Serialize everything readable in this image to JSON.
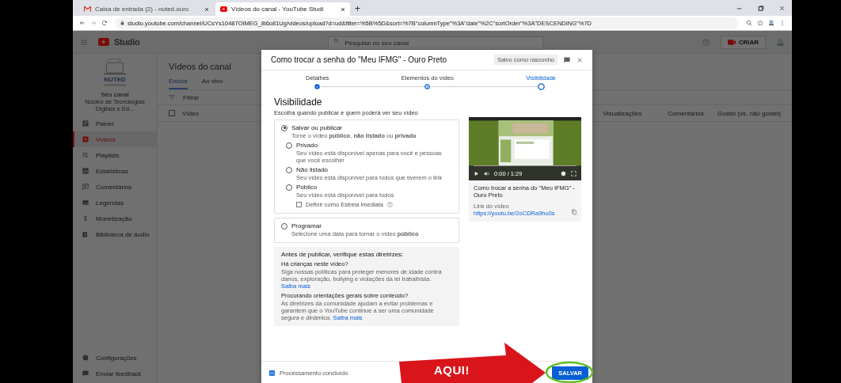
{
  "browser": {
    "tabs": [
      {
        "title": "Caixa de entrada (2) - nuted.ouro",
        "selected": false
      },
      {
        "title": "Vídeos do canal - YouTube Studi",
        "selected": true
      }
    ],
    "new_tab": "+",
    "url": "studio.youtube.com/channel/UCsYs10487OIMEG_8i6o81Ug/videos/upload?d=ud&filter=%5B%5D&sort=%7B\"columnType\"%3A\"date\"%2C\"sortOrder\"%3A\"DESCENDING\"%7D"
  },
  "header": {
    "logo": "Studio",
    "search_placeholder": "Pesquise no seu canal",
    "create": "CRIAR"
  },
  "sidebar": {
    "logo_text": "NUTED",
    "channel_label": "Seu canal",
    "channel_name": "Núcleo de Tecnologias Digitais e Ed...",
    "items": [
      {
        "label": "Painel",
        "selected": false
      },
      {
        "label": "Vídeos",
        "selected": true
      },
      {
        "label": "Playlists",
        "selected": false
      },
      {
        "label": "Estatísticas",
        "selected": false
      },
      {
        "label": "Comentários",
        "selected": false
      },
      {
        "label": "Legendas",
        "selected": false
      },
      {
        "label": "Monetização",
        "selected": false
      },
      {
        "label": "Biblioteca de áudio",
        "selected": false
      }
    ],
    "footer_items": [
      {
        "label": "Configurações"
      },
      {
        "label": "Enviar feedback"
      }
    ]
  },
  "main": {
    "title": "Vídeos do canal",
    "tabs": [
      {
        "label": "Envios",
        "selected": true
      },
      {
        "label": "Ao vivo",
        "selected": false
      }
    ],
    "filter_placeholder": "Filtrar",
    "select_all": {
      "checked": false
    },
    "columns": [
      "Vídeo",
      "Visualizações",
      "Comentários",
      "Gostei (vs. não gostei)"
    ]
  },
  "dialog": {
    "title": "Como trocar a senha do \"Meu IFMG\" - Ouro Preto",
    "saved": "Salvo como rascunho",
    "steps": [
      {
        "label": "Detalhes",
        "done": true,
        "current": false
      },
      {
        "label": "Elementos do vídeo",
        "done": false,
        "current": false
      },
      {
        "label": "Visibilidade",
        "done": false,
        "current": true
      }
    ],
    "heading": "Visibilidade",
    "subtitle": "Escolha quando publicar e quem poderá ver seu vídeo",
    "publish": {
      "label": "Salvar ou publicar",
      "selected": true,
      "description": "Torne o vídeo **público**, **não listado** ou **privado**",
      "choices": [
        {
          "label": "Privado",
          "selected": false,
          "hint": "Seu vídeo está disponível apenas para você e pessoas que você escolher"
        },
        {
          "label": "Não listado",
          "selected": false,
          "hint": "Seu vídeo está disponível para todos que tiverem o link"
        },
        {
          "label": "Público",
          "selected": false,
          "hint": "Seu vídeo está disponível para todos"
        }
      ],
      "premiere": {
        "label": "Definir como Estreia imediata",
        "checked": false
      }
    },
    "schedule": {
      "label": "Programar",
      "selected": false,
      "description": "Selecione uma data para tornar o vídeo **público**"
    },
    "guidelines": {
      "title": "Antes de publicar, verifique estas diretrizes:",
      "items": [
        {
          "question": "Há crianças neste vídeo?",
          "text": "Siga nossas políticas para proteger menores de idade contra danos, exploração, bullying e violações da lei trabalhista.",
          "link": "Saiba mais"
        },
        {
          "question": "Procurando orientações gerais sobre conteúdo?",
          "text": "As diretrizes da comunidade ajudam a evitar problemas e garantem que o YouTube continue a ser uma comunidade segura e dinâmica.",
          "link": "Saiba mais"
        }
      ]
    },
    "preview": {
      "time": "0:00 / 1:29",
      "title": "Como trocar a senha do \"Meu IFMG\" - Ouro Preto",
      "link_label": "Link do vídeo",
      "link": "https://youtu.be/2oCDRa9hu0s"
    },
    "status": "Processamento concluído",
    "save": "SALVAR"
  },
  "callout": "AQUI!"
}
